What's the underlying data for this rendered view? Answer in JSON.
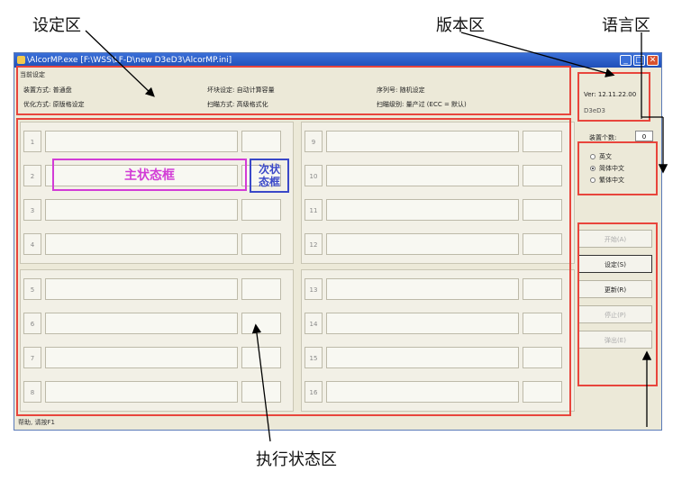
{
  "callouts": {
    "setting_area": "设定区",
    "version_area": "版本区",
    "language_area": "语言区",
    "exec_status_area": "执行状态区"
  },
  "window": {
    "title": "\\AlcorMP.exe [F:\\WSS\\LF-D\\new D3eD3\\AlcorMP.ini]",
    "min_glyph": "_",
    "max_glyph": "□",
    "close_glyph": "✕"
  },
  "settings": {
    "title": "当前设定",
    "install_mode": "装置方式: 普通盘",
    "optimize_mode": "优化方式: 原版格设定",
    "bad_block": "坏块设定: 自动计算容量",
    "scan_mode": "扫瞄方式: 高级格式化",
    "serial": "序列号: 随机设定",
    "scan_level": "扫瞄级别: 量产过 (ECC = 默认)"
  },
  "version": {
    "ver": "Ver: 12.11.22.00",
    "chip": "D3eD3"
  },
  "device_count": {
    "label": "装置个数:",
    "value": "0"
  },
  "language": {
    "options": [
      "英文",
      "简体中文",
      "繁体中文"
    ],
    "selected": "简体中文"
  },
  "buttons": {
    "start": "开始(A)",
    "setting": "设定(S)",
    "update": "更新(R)",
    "stop": "停止(P)",
    "eject": "弹出(E)"
  },
  "slots": [
    "1",
    "2",
    "3",
    "4",
    "5",
    "6",
    "7",
    "8",
    "9",
    "10",
    "11",
    "12",
    "13",
    "14",
    "15",
    "16"
  ],
  "annotations": {
    "main_status_box": "主状态框",
    "sub_status_box": "次状态框"
  },
  "statusbar": "帮助, 请按F1",
  "colors": {
    "annotation_red": "#e8453c",
    "main_status_magenta": "#d23cd6",
    "sub_status_blue": "#3a48c8",
    "titlebar_blue": "#2f5fcc"
  }
}
